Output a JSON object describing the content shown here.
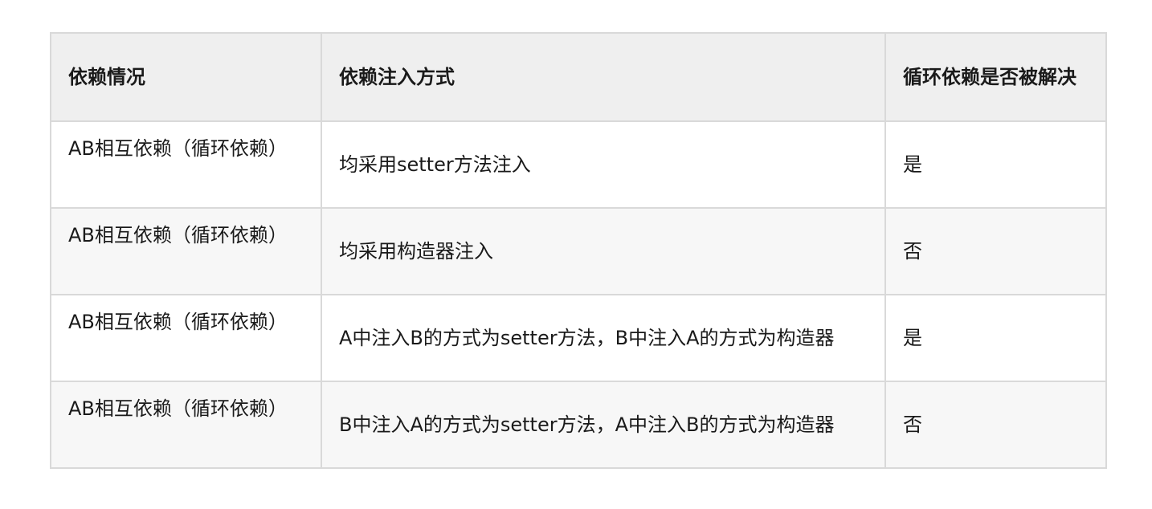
{
  "table": {
    "headers": {
      "condition": "依赖情况",
      "method": "依赖注入方式",
      "resolved": "循环依赖是否被解决"
    },
    "rows": [
      {
        "condition": "AB相互依赖（循环依赖）",
        "method": "均采用setter方法注入",
        "resolved": "是"
      },
      {
        "condition": "AB相互依赖（循环依赖）",
        "method": "均采用构造器注入",
        "resolved": "否"
      },
      {
        "condition": "AB相互依赖（循环依赖）",
        "method": "A中注入B的方式为setter方法，B中注入A的方式为构造器",
        "resolved": "是"
      },
      {
        "condition": "AB相互依赖（循环依赖）",
        "method": "B中注入A的方式为setter方法，A中注入B的方式为构造器",
        "resolved": "否"
      }
    ]
  }
}
